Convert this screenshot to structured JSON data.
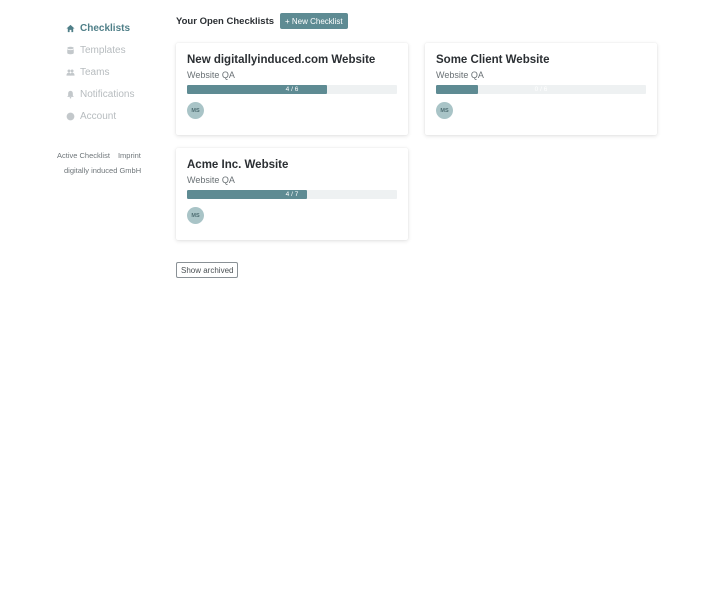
{
  "sidebar": {
    "items": [
      {
        "label": "Checklists",
        "icon": "home-icon",
        "active": true
      },
      {
        "label": "Templates",
        "icon": "database-icon",
        "active": false
      },
      {
        "label": "Teams",
        "icon": "users-icon",
        "active": false
      },
      {
        "label": "Notifications",
        "icon": "bell-icon",
        "active": false
      },
      {
        "label": "Account",
        "icon": "user-circle-icon",
        "active": false
      }
    ],
    "footer": {
      "active_checklist": "Active Checklist",
      "imprint": "Imprint",
      "company": "digitally induced GmbH"
    }
  },
  "header": {
    "title": "Your Open Checklists",
    "new_button": "+ New Checklist"
  },
  "checklists": [
    {
      "title": "New digitallyinduced.com Website",
      "subtitle": "Website QA",
      "progress_text": "4 / 6",
      "done": 4,
      "total": 6,
      "avatar": "MS"
    },
    {
      "title": "Some Client Website",
      "subtitle": "Website QA",
      "progress_text": "0 / 6",
      "done": 0,
      "total": 6,
      "avatar": "MS"
    },
    {
      "title": "Acme Inc. Website",
      "subtitle": "Website QA",
      "progress_text": "4 / 7",
      "done": 4,
      "total": 7,
      "avatar": "MS"
    }
  ],
  "show_archived": "Show archived",
  "colors": {
    "accent": "#5e8b93",
    "nav_active": "#4f7f88",
    "nav_inactive": "#b7bcbf",
    "progress_track": "#eef1f2",
    "avatar_bg": "#a9c4c7"
  }
}
